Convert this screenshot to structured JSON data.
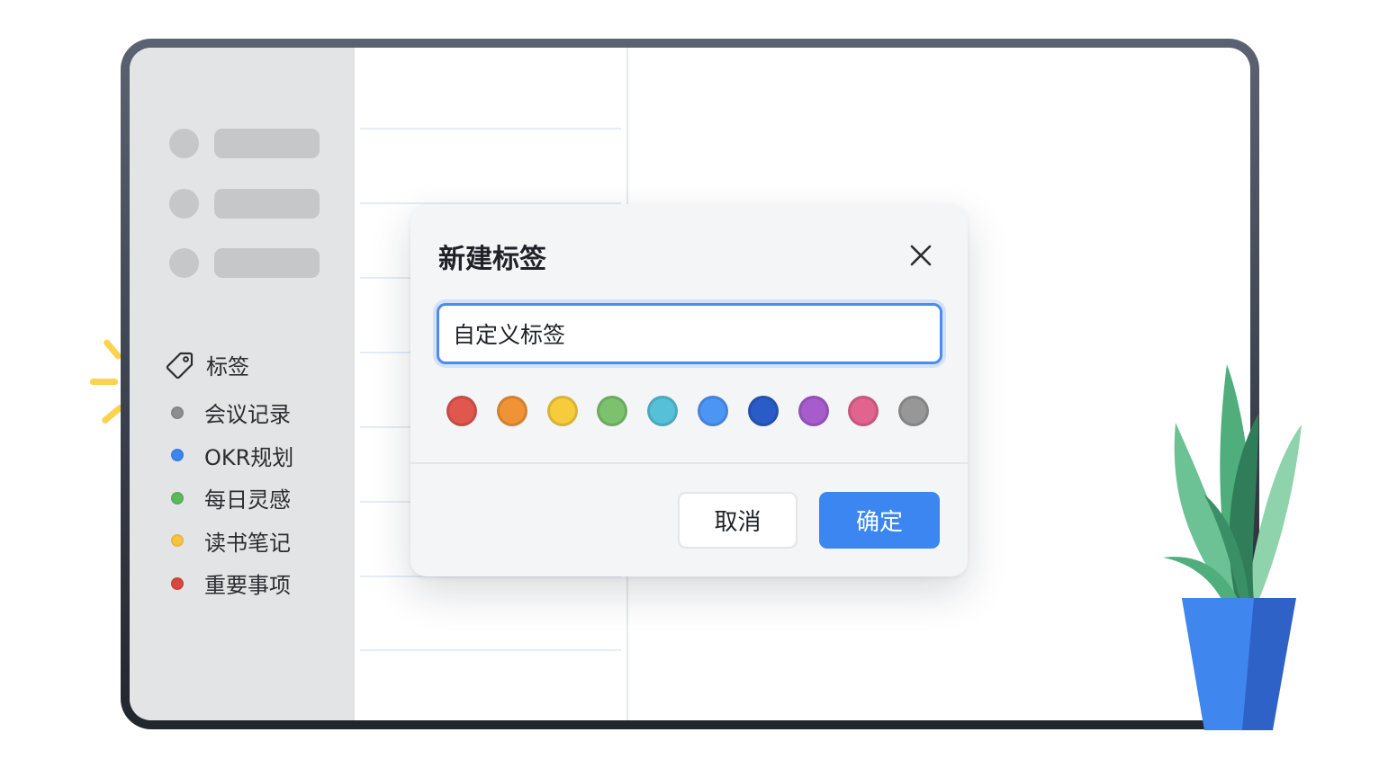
{
  "sidebar": {
    "tags_label": "标签",
    "tags": [
      {
        "label": "会议记录",
        "color": "#8e8e90"
      },
      {
        "label": "OKR规划",
        "color": "#3b86f0"
      },
      {
        "label": "每日灵感",
        "color": "#5cb85c"
      },
      {
        "label": "读书笔记",
        "color": "#f6c443"
      },
      {
        "label": "重要事项",
        "color": "#d9473e"
      }
    ]
  },
  "dialog": {
    "title": "新建标签",
    "input_value": "自定义标签",
    "colors": [
      {
        "name": "red",
        "hex": "#e0574f"
      },
      {
        "name": "orange",
        "hex": "#ef9336"
      },
      {
        "name": "yellow",
        "hex": "#f7cc3c"
      },
      {
        "name": "green",
        "hex": "#7cc26e"
      },
      {
        "name": "cyan",
        "hex": "#56c0d8"
      },
      {
        "name": "blue",
        "hex": "#4d95f5"
      },
      {
        "name": "dark-blue",
        "hex": "#2a5cc7"
      },
      {
        "name": "purple",
        "hex": "#a65ccc"
      },
      {
        "name": "pink",
        "hex": "#e0648e"
      },
      {
        "name": "gray",
        "hex": "#979797"
      }
    ],
    "cancel_label": "取消",
    "confirm_label": "确定"
  },
  "theme": {
    "accent": "#3b86f0"
  }
}
